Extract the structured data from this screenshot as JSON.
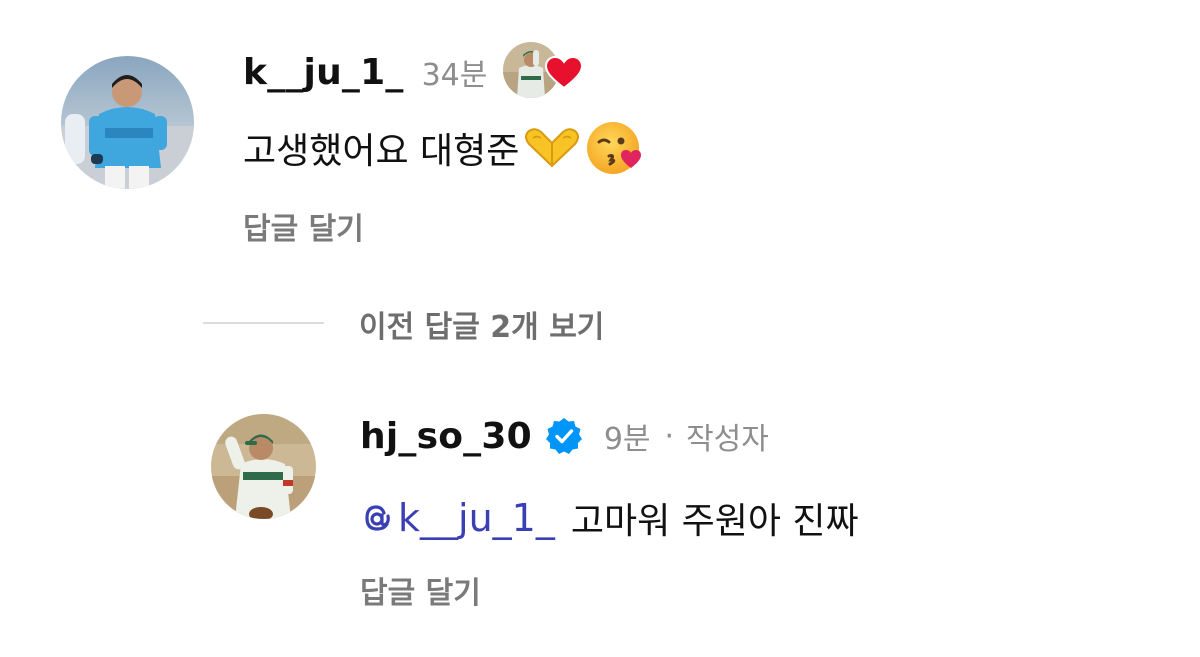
{
  "comment_1": {
    "username": "k__ju_1_",
    "time": "34분",
    "text": "고생했어요 대형준",
    "emoji": [
      "heart-hands",
      "kissing-face"
    ],
    "reply_label": "답글 달기",
    "liked_by_author": true
  },
  "previous_replies": {
    "label": "이전 답글 2개 보기"
  },
  "comment_2": {
    "username": "hj_so_30",
    "verified": true,
    "time": "9분",
    "separator": "·",
    "author_tag": "작성자",
    "mention": "k__ju_1_",
    "text": "고마워 주원아 진짜",
    "reply_label": "답글 달기"
  },
  "colors": {
    "mention": "#3b3fb4",
    "secondary_text": "#8e8e8e",
    "verified_badge": "#0095f6",
    "like_heart": "#e8112d"
  }
}
